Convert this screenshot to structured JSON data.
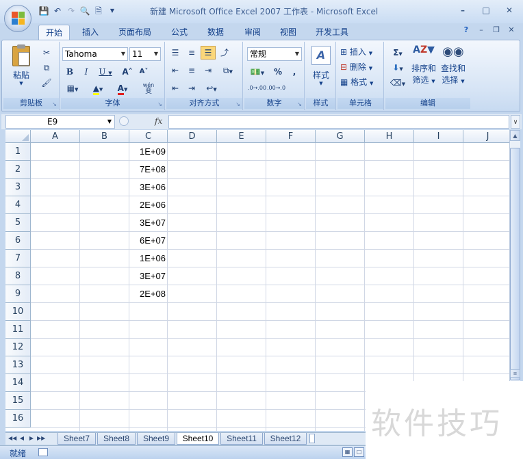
{
  "window": {
    "title": "新建 Microsoft Office Excel 2007 工作表 - Microsoft Excel",
    "controls": [
      "–",
      "□",
      "✕"
    ]
  },
  "ribbon_tabs": [
    "开始",
    "插入",
    "页面布局",
    "公式",
    "数据",
    "审阅",
    "视图",
    "开发工具"
  ],
  "ribbon": {
    "clipboard": {
      "label": "剪贴板",
      "paste": "粘贴"
    },
    "font": {
      "label": "字体",
      "font_name": "Tahoma",
      "font_size": "11",
      "bold": "B",
      "italic": "I",
      "underline": "U",
      "grow": "A˄",
      "shrink": "A˅",
      "phonetic": "wén",
      "phonetic_char": "变"
    },
    "alignment": {
      "label": "对齐方式"
    },
    "number": {
      "label": "数字",
      "format": "常规",
      "percent": "%",
      "comma": ",",
      "inc_dec": ".0→.00",
      "dec_dec": ".00→.0"
    },
    "styles": {
      "label": "样式"
    },
    "cells": {
      "label": "单元格",
      "insert": "插入",
      "delete": "删除",
      "format": "格式"
    },
    "editing": {
      "label": "编辑",
      "sort_filter_1": "排序和",
      "sort_filter_2": "筛选",
      "find_select_1": "查找和",
      "find_select_2": "选择",
      "sigma": "Σ"
    }
  },
  "formula_bar": {
    "name_box": "E9",
    "fx": "fx",
    "formula": ""
  },
  "columns": [
    "A",
    "B",
    "C",
    "D",
    "E",
    "F",
    "G",
    "H",
    "I",
    "J"
  ],
  "rows": [
    "1",
    "2",
    "3",
    "4",
    "5",
    "6",
    "7",
    "8",
    "9",
    "10",
    "11",
    "12",
    "13",
    "14",
    "15",
    "16"
  ],
  "column_c_values": [
    "1E+09",
    "7E+08",
    "3E+06",
    "2E+06",
    "3E+07",
    "6E+07",
    "1E+06",
    "3E+07",
    "2E+08"
  ],
  "sheets": [
    "Sheet7",
    "Sheet8",
    "Sheet9",
    "Sheet10",
    "Sheet11",
    "Sheet12"
  ],
  "active_sheet": "Sheet10",
  "status": {
    "text": "就绪"
  },
  "watermark": "软件技巧"
}
